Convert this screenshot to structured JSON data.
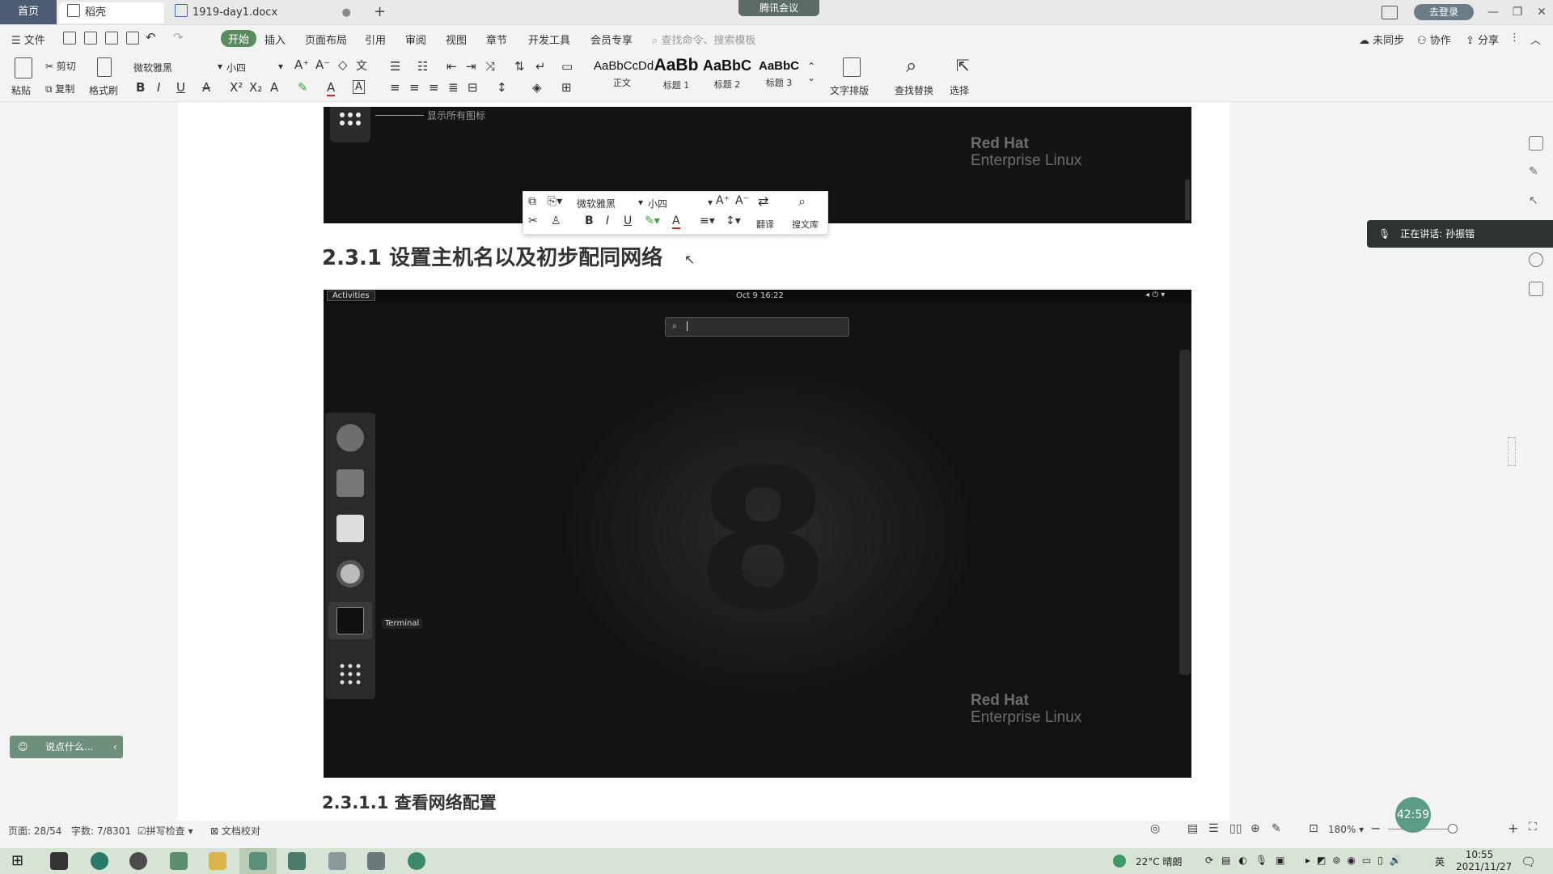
{
  "titlebar": {
    "tab_home": "首页",
    "tab_daoke": "稻壳",
    "tab_doc": "1919-day1.docx",
    "new_tab": "+",
    "meeting": "腾讯会议",
    "login": "去登录"
  },
  "menubar": {
    "file": "文件",
    "items": [
      "开始",
      "插入",
      "页面布局",
      "引用",
      "审阅",
      "视图",
      "章节",
      "开发工具",
      "会员专享"
    ],
    "search_placeholder": "查找命令、搜索模板",
    "sync": "未同步",
    "collab": "协作",
    "share": "分享"
  },
  "ribbon": {
    "paste": "粘贴",
    "cut": "剪切",
    "copy": "复制",
    "format_painter": "格式刷",
    "font_name": "微软雅黑",
    "font_size": "小四",
    "styles": [
      {
        "preview": "AaBbCcDd",
        "label": "正文"
      },
      {
        "preview": "AaBb",
        "label": "标题 1"
      },
      {
        "preview": "AaBbC",
        "label": "标题 2"
      },
      {
        "preview": "AaBbC",
        "label": "标题 3"
      }
    ],
    "text_layout": "文字排版",
    "find_replace": "查找替换",
    "select": "选择"
  },
  "document": {
    "annotation_label": "显示所有图标",
    "redhat_line1": "Red Hat",
    "redhat_line2": "Enterprise Linux",
    "heading_231": "2.3.1 设置主机名以及初步配同网络",
    "heading_2311": "2.3.1.1 查看网络配置",
    "screenshot2": {
      "activities": "Activities",
      "datetime": "Oct 9  16:22",
      "terminal_tooltip": "Terminal"
    }
  },
  "mini_toolbar": {
    "font_name": "微软雅黑",
    "font_size": "小四",
    "translate": "翻译",
    "search_lib": "搜文库"
  },
  "side_panel": {
    "speaking": "正在讲话: 孙振锴"
  },
  "bubble": {
    "text": "说点什么..."
  },
  "statusbar": {
    "page": "页面: 28/54",
    "words": "字数: 7/8301",
    "spell": "拼写检查",
    "proof": "文档校对",
    "zoom": "180%",
    "timer": "42:59"
  },
  "taskbar": {
    "weather": "22°C 晴朗",
    "ime": "英",
    "time": "10:55",
    "date": "2021/11/27"
  }
}
